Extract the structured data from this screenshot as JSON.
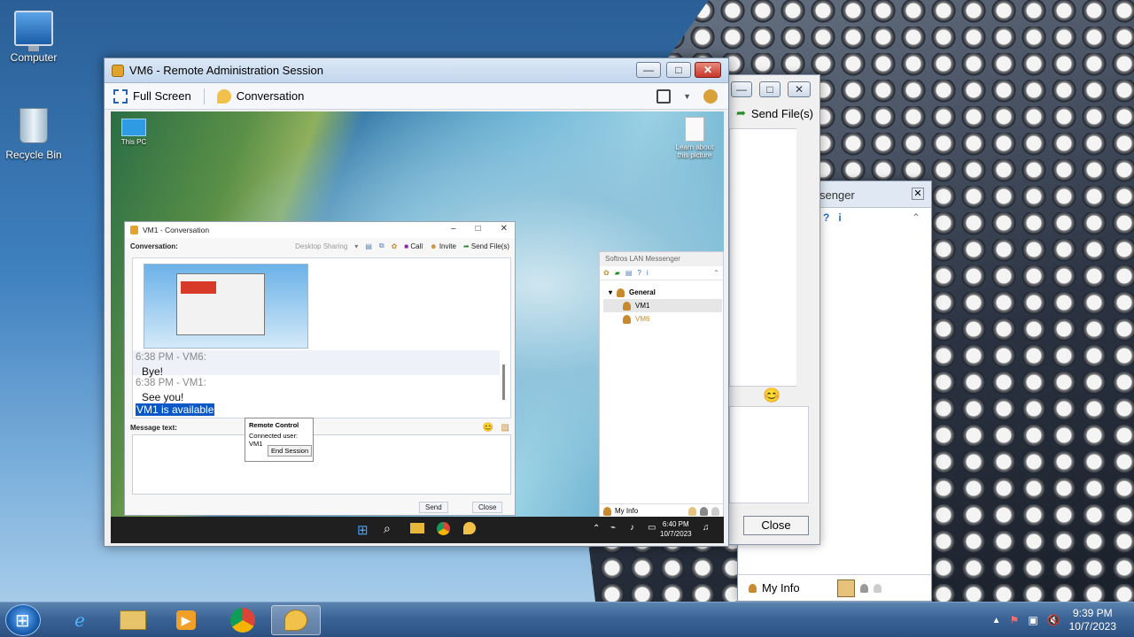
{
  "desktop": {
    "icons": [
      {
        "label": "Computer"
      },
      {
        "label": "Recycle Bin"
      }
    ]
  },
  "main_window": {
    "title": "VM6 - Remote Administration Session",
    "toolbar": {
      "full_screen": "Full Screen",
      "conversation": "Conversation"
    }
  },
  "remote_desktop": {
    "icons": [
      {
        "label": "This PC"
      },
      {
        "label": "Learn about this picture"
      }
    ],
    "taskbar": {
      "time": "6:40 PM",
      "date": "10/7/2023"
    }
  },
  "conversation_window": {
    "title": "VM1 - Conversation",
    "conversation_label": "Conversation:",
    "toolbar": {
      "desktop_sharing": "Desktop Sharing",
      "call": "Call",
      "invite": "Invite",
      "send_files": "Send File(s)"
    },
    "messages": [
      {
        "header": "6:38 PM - VM6:",
        "body": "Bye!"
      },
      {
        "header": "6:38 PM - VM1:",
        "body": "See you!"
      }
    ],
    "status_selected": "VM1 is available",
    "message_text_label": "Message text:",
    "send_label": "Send",
    "close_label": "Close"
  },
  "remote_control_popup": {
    "title": "Remote Control",
    "connected": "Connected user: VM1",
    "end_session": "End Session"
  },
  "remote_lan_messenger": {
    "title": "Softros LAN Messenger",
    "group": "General",
    "users": [
      "VM1",
      "VM6"
    ],
    "footer": "My Info"
  },
  "background_windows": {
    "send_files": "Send File(s)",
    "messenger_title_fragment": "senger",
    "close_label": "Close",
    "my_info": "My Info"
  },
  "taskbar": {
    "time": "9:39 PM",
    "date": "10/7/2023"
  }
}
